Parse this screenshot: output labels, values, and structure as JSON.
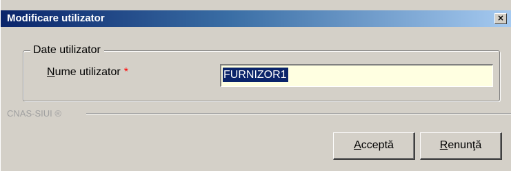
{
  "window": {
    "title": "Modificare utilizator",
    "close_glyph": "×"
  },
  "group": {
    "legend": "Date utilizator"
  },
  "field": {
    "label_mnemonic": "N",
    "label_rest": "ume utilizator",
    "required_marker": "*",
    "value": "FURNIZOR1"
  },
  "footer": {
    "brand": "CNAS-SIUI ®"
  },
  "buttons": {
    "accept_mnemonic": "A",
    "accept_rest": "cceptă",
    "cancel_mnemonic": "R",
    "cancel_rest": "enunţă"
  },
  "colors": {
    "titlebar_start": "#0a246a",
    "titlebar_end": "#a6caf0",
    "face": "#d4d0c8",
    "input_background": "#ffffe1",
    "selection": "#0a246a",
    "required": "#ff0000"
  },
  "icons": {
    "close": "close-icon"
  }
}
